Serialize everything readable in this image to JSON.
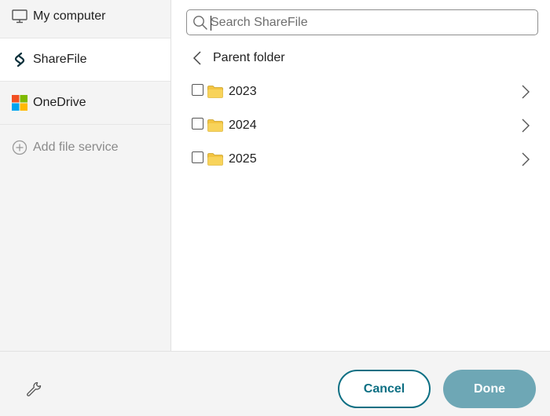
{
  "sidebar": {
    "items": [
      {
        "label": "My computer",
        "icon": "monitor-icon"
      },
      {
        "label": "ShareFile",
        "icon": "sharefile-logo-icon"
      },
      {
        "label": "OneDrive",
        "icon": "onedrive-logo-icon"
      }
    ],
    "add_label": "Add file service"
  },
  "search": {
    "placeholder": "Search ShareFile",
    "value": ""
  },
  "nav": {
    "parent_label": "Parent folder"
  },
  "folders": [
    {
      "name": "2023"
    },
    {
      "name": "2024"
    },
    {
      "name": "2025"
    }
  ],
  "footer": {
    "cancel_label": "Cancel",
    "done_label": "Done"
  },
  "colors": {
    "accent": "#0d6f83",
    "done_disabled": "#6ea7b5",
    "folder": "#f3c441",
    "sidebar_bg": "#f4f4f4"
  }
}
